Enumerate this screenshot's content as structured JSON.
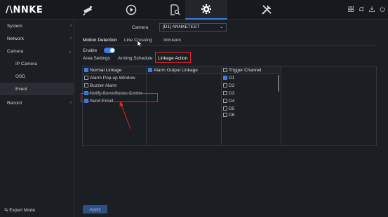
{
  "app": {
    "logo_text": "/\\NNKE"
  },
  "topnav": [
    {
      "name": "live-view",
      "icon": "camera-icon"
    },
    {
      "name": "playback",
      "icon": "playback-icon"
    },
    {
      "name": "search",
      "icon": "file-search-icon"
    },
    {
      "name": "configuration",
      "icon": "gear-icon",
      "active": true
    },
    {
      "name": "maintenance",
      "icon": "tools-icon"
    }
  ],
  "right_icons": [
    "grid-icon",
    "alarm-icon",
    "download-icon",
    "power-icon"
  ],
  "sidebar": {
    "items": [
      {
        "label": "System",
        "has_chevron": true,
        "chevron": "›"
      },
      {
        "label": "Network",
        "has_chevron": true,
        "chevron": "›"
      },
      {
        "label": "Camera",
        "has_chevron": true,
        "chevron": "⌄"
      },
      {
        "label": "IP Camera",
        "sub": true
      },
      {
        "label": "OSD",
        "sub": true
      },
      {
        "label": "Event",
        "sub": true,
        "active": true
      },
      {
        "label": "Record",
        "has_chevron": true,
        "chevron": "›"
      }
    ],
    "expert_mode": "⇆ Expert Mode"
  },
  "camera": {
    "label": "Camera",
    "value": "[D1] ANNKETEST",
    "dropdown_glyph": "⌄"
  },
  "tabs_top": [
    {
      "label": "Motion Detection",
      "active": true
    },
    {
      "label": "Line Crossing"
    },
    {
      "label": "Intrusion"
    }
  ],
  "enable": {
    "label": "Enable",
    "on": true
  },
  "tabs_sub": [
    {
      "label": "Area Settings"
    },
    {
      "label": "Arming Schedule"
    },
    {
      "label": "Linkage Action",
      "active": true
    }
  ],
  "columns": {
    "normal_linkage": {
      "header": "Normal Linkage",
      "items": [
        {
          "label": "Alarm Pop-up Window",
          "checked": false
        },
        {
          "label": "Buzzer Alarm",
          "checked": false
        },
        {
          "label": "Notify Surveillance Center",
          "checked": true
        },
        {
          "label": "Send Email",
          "checked": true
        }
      ]
    },
    "alarm_output": {
      "header": "Alarm Output Linkage"
    },
    "trigger_channel": {
      "header": "Trigger Channel",
      "items": [
        {
          "label": "D1",
          "checked": true
        },
        {
          "label": "D2",
          "checked": false
        },
        {
          "label": "D3",
          "checked": false
        },
        {
          "label": "D4",
          "checked": false
        },
        {
          "label": "D5",
          "checked": false
        },
        {
          "label": "D6",
          "checked": false
        }
      ]
    }
  },
  "apply_label": "Apply",
  "colors": {
    "accent": "#3b7de3",
    "highlight": "#e2232a",
    "background": "#1b1e22"
  }
}
